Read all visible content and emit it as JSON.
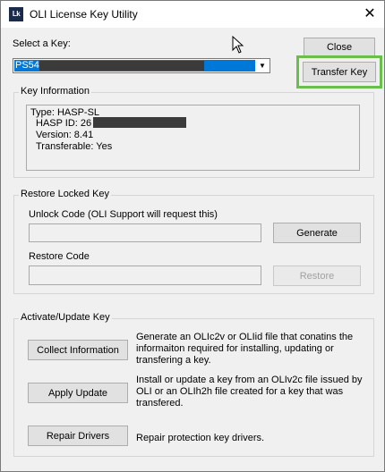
{
  "window": {
    "title": "OLI License Key Utility",
    "icon_text": "Lk",
    "close_glyph": "✕"
  },
  "select_key": {
    "label": "Select a Key:",
    "selected_value": "PS54",
    "dropdown_arrow": "▼"
  },
  "buttons": {
    "close": "Close",
    "transfer_key": "Transfer Key",
    "generate": "Generate",
    "restore": "Restore",
    "collect_information": "Collect Information",
    "apply_update": "Apply Update",
    "repair_drivers": "Repair Drivers"
  },
  "key_information": {
    "title": "Key Information",
    "type": "Type: HASP-SL",
    "hasp_id": "HASP ID: 26",
    "version": "Version: 8.41",
    "transferable": "Transferable: Yes"
  },
  "restore_locked_key": {
    "title": "Restore Locked Key",
    "unlock_code_label": "Unlock Code (OLI Support will request this)",
    "unlock_code_value": "",
    "restore_code_label": "Restore Code",
    "restore_code_value": ""
  },
  "activate_update": {
    "title": "Activate/Update Key",
    "collect_desc": "Generate an OLIc2v or OLIid file that conatins the informaiton required for installing, updating or transfering a key.",
    "apply_desc": "Install or update a key from an OLIv2c file issued by OLI or an OLIh2h file created for a key that was transfered.",
    "repair_desc": "Repair protection key drivers."
  },
  "colors": {
    "highlight": "#6abf4b",
    "selection": "#0078d7"
  }
}
